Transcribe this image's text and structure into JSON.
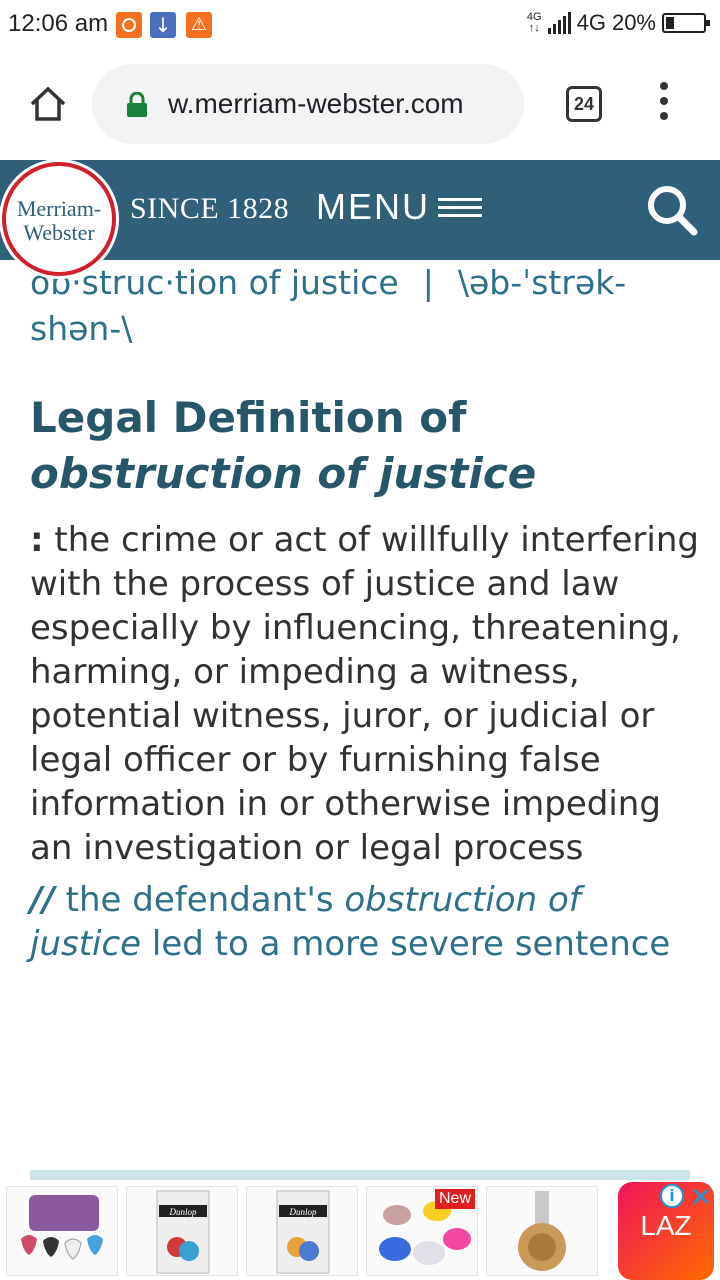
{
  "status_bar": {
    "time": "12:06 am",
    "network_top": "4G",
    "network_label": "4G",
    "battery": "20%"
  },
  "browser": {
    "url": "w.merriam-webster.com",
    "tab_count": "24"
  },
  "site_header": {
    "logo_line1": "Merriam-",
    "logo_line2": "Webster",
    "since": "SINCE 1828",
    "menu_label": "MENU"
  },
  "entry": {
    "pronunciation_headword": "ob·struc·tion of justice",
    "separator": "|",
    "pronunciation": "\\əb-ˈstrək-shən-\\",
    "legal_title_prefix": "Legal Definition of",
    "legal_title_term": "obstruction of justice",
    "definition_colon": ":",
    "definition": " the crime or act of willfully interfering with the process of justice and law especially by influencing, threatening, harming, or impeding a witness, potential witness, juror, or judicial or legal officer or by furnishing false information in or otherwise impeding an investigation or legal process",
    "example_marker": "//",
    "example_before": " the defendant's ",
    "example_term": "obstruction of justice",
    "example_after": " led to a more severe sentence"
  },
  "ad": {
    "new_badge": "New",
    "laz_logo": "LAZ",
    "info_icon": "i",
    "close_icon": "✕",
    "product_labels": [
      "Dunlop",
      "Dunlop"
    ]
  },
  "colors": {
    "header_bg": "#305f7a",
    "title_color": "#265667",
    "link_color": "#2e6f8a",
    "logo_ring": "#d21f2b"
  }
}
